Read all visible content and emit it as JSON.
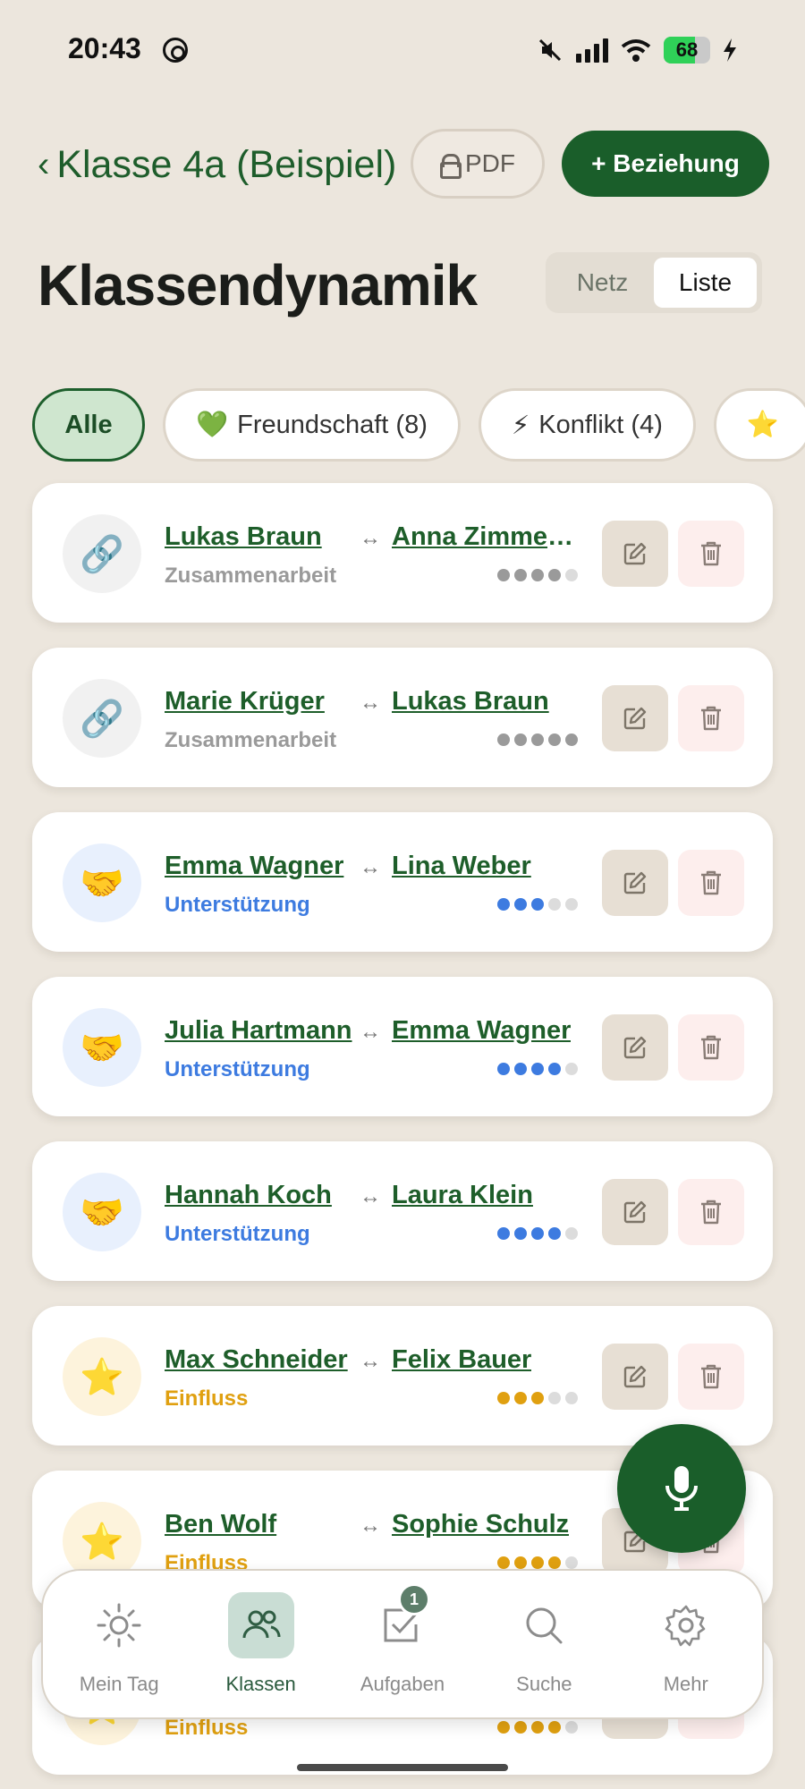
{
  "status_bar": {
    "time": "20:43",
    "battery": "68"
  },
  "header": {
    "back_label": "Klasse 4a (Beispiel)",
    "pdf_label": "PDF",
    "add_label": "+ Beziehung"
  },
  "page": {
    "title": "Klassendynamik"
  },
  "view_toggle": {
    "options": [
      "Netz",
      "Liste"
    ],
    "active": "Liste"
  },
  "filters": [
    {
      "label": "Alle",
      "emoji": ""
    },
    {
      "label": "Freundschaft (8)",
      "emoji": "💚"
    },
    {
      "label": "Konflikt (4)",
      "emoji": "⚡"
    },
    {
      "label": "",
      "emoji": "⭐"
    }
  ],
  "relations": [
    {
      "a": "Lukas Braun",
      "b": "Anna Zimmer…",
      "type": "Zusammenarbeit",
      "kind": "collab",
      "strength": 4,
      "icon": "🔗"
    },
    {
      "a": "Marie Krüger",
      "b": "Lukas Braun",
      "type": "Zusammenarbeit",
      "kind": "collab",
      "strength": 5,
      "icon": "🔗"
    },
    {
      "a": "Emma Wagner",
      "b": "Lina Weber",
      "type": "Unterstützung",
      "kind": "support",
      "strength": 3,
      "icon": "🤝"
    },
    {
      "a": "Julia Hartmann",
      "b": "Emma Wagner",
      "type": "Unterstützung",
      "kind": "support",
      "strength": 4,
      "icon": "🤝"
    },
    {
      "a": "Hannah Koch",
      "b": "Laura Klein",
      "type": "Unterstützung",
      "kind": "support",
      "strength": 4,
      "icon": "🤝"
    },
    {
      "a": "Max Schneider",
      "b": "Felix Bauer",
      "type": "Einfluss",
      "kind": "influence",
      "strength": 3,
      "icon": "⭐"
    },
    {
      "a": "Ben Wolf",
      "b": "Sophie Schulz",
      "type": "Einfluss",
      "kind": "influence",
      "strength": 4,
      "icon": "⭐"
    },
    {
      "a": "",
      "b": "",
      "type": "Einfluss",
      "kind": "influence",
      "strength": 4,
      "icon": "⭐"
    }
  ],
  "arrow_glyph": "↔",
  "colors": {
    "brand": "#1a5e2a",
    "collab": "#9a9a9a",
    "collab_bg": "#f1f1f1",
    "support": "#3d7be0",
    "support_bg": "#e8f0fd",
    "influence": "#e0a010",
    "influence_bg": "#fdf3dc",
    "dot_off": "#dcdcdc"
  },
  "nav": [
    {
      "label": "Mein Tag",
      "icon": "sun-icon"
    },
    {
      "label": "Klassen",
      "icon": "users-icon",
      "active": true
    },
    {
      "label": "Aufgaben",
      "icon": "checkbox-icon",
      "badge": "1"
    },
    {
      "label": "Suche",
      "icon": "search-icon"
    },
    {
      "label": "Mehr",
      "icon": "gear-icon"
    }
  ]
}
